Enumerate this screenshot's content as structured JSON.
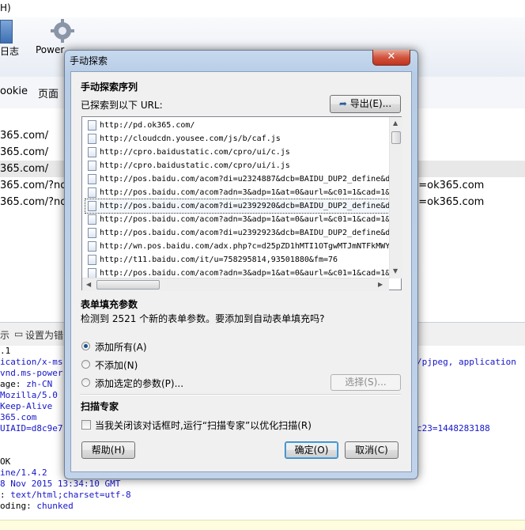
{
  "background": {
    "menubar_text": "H)",
    "toolbar": {
      "label1": "日志",
      "label2": "Power"
    },
    "tabs": [
      "ookie",
      "页面"
    ],
    "rows": [
      {
        "left": "365.com/",
        "right": ""
      },
      {
        "left": "365.com/",
        "right": ""
      },
      {
        "left": "365.com/",
        "right": ""
      },
      {
        "left": "365.com/?nosc",
        "right": "n=ok365.com"
      },
      {
        "left": "365.com/?nosc",
        "right": "n=ok365.com"
      }
    ],
    "lower_bar": {
      "item1": "示",
      "item2": "设置为错"
    },
    "header_lines": [
      {
        "k": ".1",
        "v": ""
      },
      {
        "k": "",
        "v": "ication/x-ms"
      },
      {
        "k": "",
        "v": "vnd.ms-power"
      },
      {
        "k": "age: ",
        "v": "zh-CN"
      },
      {
        "k": "",
        "v": "Mozilla/5.0"
      },
      {
        "k": "",
        "v": "Keep-Alive"
      },
      {
        "k": "",
        "v": "365.com"
      },
      {
        "k": "",
        "v": "UIAID=d8c9e7"
      },
      {
        "k": "",
        "v": ""
      },
      {
        "k": "",
        "v": ""
      },
      {
        "k": " OK",
        "v": ""
      },
      {
        "k": "",
        "v": "ine/1.4.2"
      },
      {
        "k": "",
        "v": "8 Nov 2015 13:34:10 GMT"
      },
      {
        "k": ": ",
        "v": "text/html;charset=utf-8"
      },
      {
        "k": "oding: ",
        "v": "chunked"
      }
    ],
    "right_fragments": {
      "line1": "/pjpeg, application",
      "line7": "c23=1448283188"
    }
  },
  "dialog": {
    "title": "手动探索",
    "close_glyph": "✕",
    "section1_title": "手动探索序列",
    "explored_label": "已探索到以下 URL:",
    "export_button": "导出(E)...",
    "urls": [
      "http://pd.ok365.com/",
      "http://cloudcdn.yousee.com/js/b/caf.js",
      "http://cpro.baidustatic.com/cpro/ui/c.js",
      "http://cpro.baidustatic.com/cpro/ui/i.js",
      "http://pos.baidu.com/acom?di=u2324887&dcb=BAIDU_DUP2_define&d",
      "http://pos.baidu.com/acom?adn=3&adp=1&at=0&aurl=&c01=1&cad=1&",
      "http://pos.baidu.com/acom?di=u2392920&dcb=BAIDU_DUP2_define&d",
      "http://pos.baidu.com/acom?adn=3&adp=1&at=0&aurl=&c01=1&cad=1&",
      "http://pos.baidu.com/acom?di=u2392923&dcb=BAIDU_DUP2_define&d",
      "http://wn.pos.baidu.com/adx.php?c=d25pZD1hMTI1OTgwMTJmNTFkMWY",
      "http://t11.baidu.com/it/u=758295814,93501880&fm=76",
      "http://pos.baidu.com/acom?adn=3&adp=1&at=0&aurl=&c01=1&cad=1&"
    ],
    "section2_title": "表单填充参数",
    "detected_text": "检测到 2521 个新的表单参数。要添加到自动表单填充吗?",
    "radios": [
      {
        "label": "添加所有(A)",
        "checked": true
      },
      {
        "label": "不添加(N)",
        "checked": false
      },
      {
        "label": "添加选定的参数(P)...",
        "checked": false
      }
    ],
    "select_button": "选择(S)...",
    "section3_title": "扫描专家",
    "scan_checkbox_label": "当我关闭该对话框时,运行“扫描专家”以优化扫描(R)",
    "help_button": "帮助(H)",
    "ok_button": "确定(O)",
    "cancel_button": "取消(C)"
  }
}
